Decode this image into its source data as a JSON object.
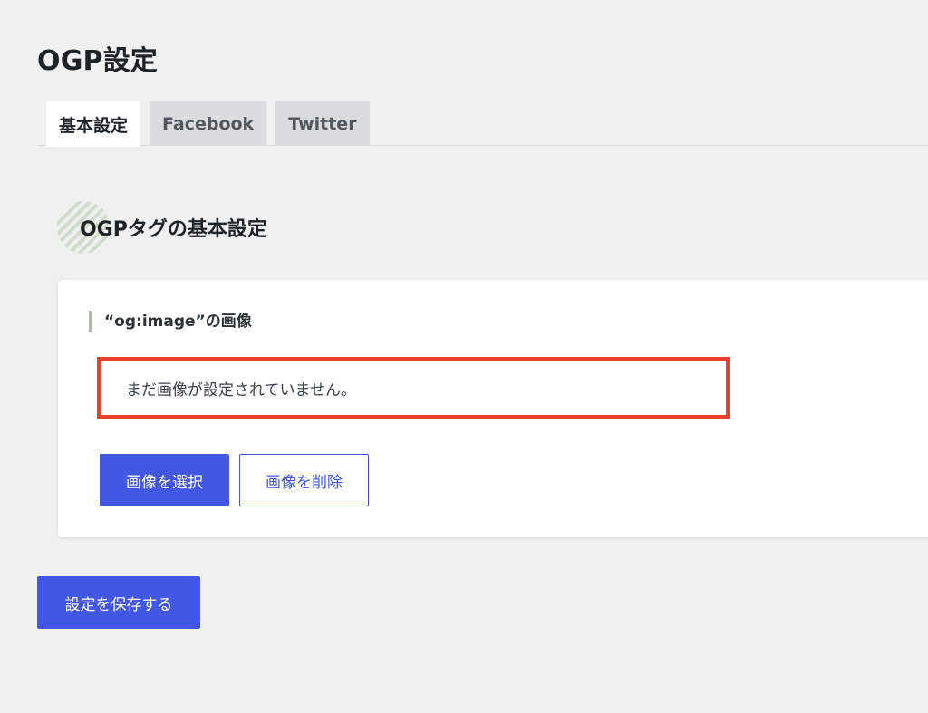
{
  "page": {
    "title": "OGP設定"
  },
  "tabs": [
    {
      "label": "基本設定",
      "active": true
    },
    {
      "label": "Facebook",
      "active": false
    },
    {
      "label": "Twitter",
      "active": false
    }
  ],
  "section": {
    "heading": "OGPタグの基本設定"
  },
  "image_field": {
    "label": "“og:image”の画像",
    "status_text": "まだ画像が設定されていません。",
    "select_label": "画像を選択",
    "delete_label": "画像を削除"
  },
  "footer": {
    "save_label": "設定を保存する"
  },
  "colors": {
    "accent": "#4258e4",
    "highlight_border": "#e8402b",
    "label_bar": "#a7bea1",
    "background": "#f0f0f1"
  }
}
